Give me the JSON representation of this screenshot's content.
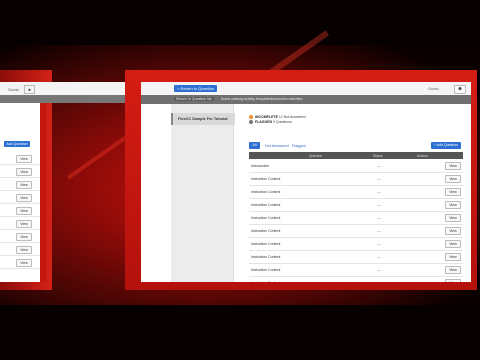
{
  "topbar": {
    "main_button": "Return to Question",
    "user_label": "Guest",
    "user_icon": "user-icon"
  },
  "breadcrumb": [
    "Return to Question list",
    "Some catalog activity templates",
    "Instruction activities"
  ],
  "sidebar": {
    "selected_item": "FlexCC Sample For Tutorial"
  },
  "status": {
    "incomplete_label": "INCOMPLETE",
    "incomplete_detail": "12 Not Answered",
    "flagged_label": "FLAGGED",
    "flagged_detail": "0 Questions",
    "incomplete_color": "#e8902a",
    "flagged_color": "#777777"
  },
  "tabs": {
    "selected": "All",
    "others": [
      "Not Answered",
      "Flagged"
    ]
  },
  "add_button": "Add Question",
  "left_window": {
    "add_button": "Add Question",
    "user_label": "Guest",
    "view_button": "View"
  },
  "table": {
    "headers": [
      "Question",
      "Status",
      "Actions"
    ],
    "rows": [
      {
        "name": "Introduction",
        "status": "—",
        "action": "View"
      },
      {
        "name": "Instruction Content",
        "status": "—",
        "action": "View"
      },
      {
        "name": "Instruction Content",
        "status": "—",
        "action": "View"
      },
      {
        "name": "Instruction Content",
        "status": "—",
        "action": "View"
      },
      {
        "name": "Instruction Content",
        "status": "—",
        "action": "View"
      },
      {
        "name": "Instruction Content",
        "status": "—",
        "action": "View"
      },
      {
        "name": "Instruction Content",
        "status": "—",
        "action": "View"
      },
      {
        "name": "Instruction Content",
        "status": "—",
        "action": "View"
      },
      {
        "name": "Instruction Content",
        "status": "—",
        "action": "View"
      },
      {
        "name": "Instruction Content",
        "status": "—",
        "action": "View"
      }
    ]
  },
  "colors": {
    "accent": "#2d6fd2",
    "frame_red": "#c4160f"
  }
}
